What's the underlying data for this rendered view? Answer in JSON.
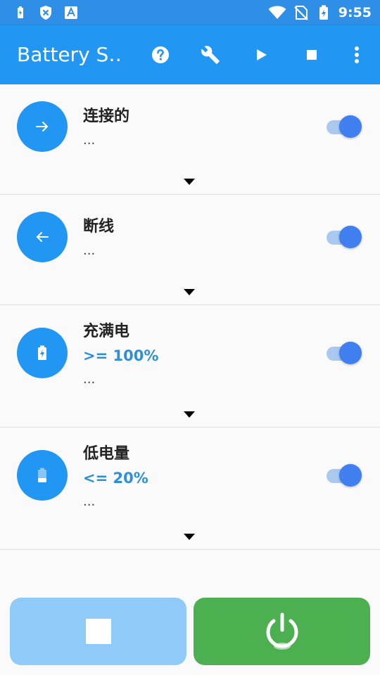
{
  "status_bar": {
    "time": "9:55",
    "left_icons": [
      "battery-small-icon",
      "shield-x-icon",
      "font-a-icon"
    ],
    "right_icons": [
      "wifi-icon",
      "no-sim-icon",
      "battery-charging-icon"
    ]
  },
  "app_bar": {
    "title": "Battery S…",
    "actions": [
      "help-icon",
      "wrench-icon",
      "play-icon",
      "stop-icon",
      "more-vert-icon"
    ]
  },
  "cards": [
    {
      "icon": "arrow-right-icon",
      "title": "连接的",
      "sub": "",
      "dots": "...",
      "enabled": true
    },
    {
      "icon": "arrow-left-icon",
      "title": "断线",
      "sub": "",
      "dots": "...",
      "enabled": true
    },
    {
      "icon": "battery-charging-icon",
      "title": "充满电",
      "sub": ">= 100%",
      "dots": "...",
      "enabled": true
    },
    {
      "icon": "battery-low-icon",
      "title": "低电量",
      "sub": "<= 20%",
      "dots": "...",
      "enabled": true
    }
  ],
  "bottom": {
    "stop_icon": "stop-square-icon",
    "power_icon": "power-icon"
  },
  "colors": {
    "status_bar": "#2f8fe6",
    "app_bar": "#2196f3",
    "accent": "#2196f3",
    "sub_text": "#2d8fd8",
    "stop_button": "#90caf9",
    "power_button": "#4caf50"
  }
}
